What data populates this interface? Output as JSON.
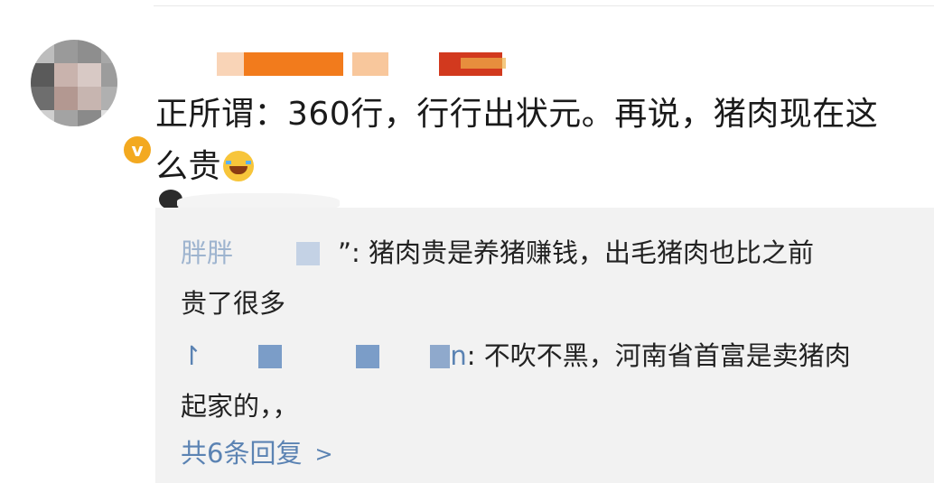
{
  "comment": {
    "author_name": "",
    "text_line1": "正所谓：360行，行行出状元。再说，猪肉现在这",
    "text_line2": "么贵",
    "emoji": "laughing-crying-emoji",
    "verified_badge": "v"
  },
  "replies": [
    {
      "author": "胖胖",
      "separator": "”: ",
      "text_line1": "猪肉贵是养猪赚钱，出毛猪肉也比之前",
      "text_line2": "贵了很多"
    },
    {
      "author": "↾",
      "author_tail": "n",
      "separator": ": ",
      "text_line1": "不吹不黑，河南省首富是卖猪肉",
      "text_line2": "起家的，，"
    }
  ],
  "more_replies_label": "共6条回复",
  "more_replies_chevron": ">",
  "colors": {
    "link_blue": "#5b83b3",
    "reply_bg": "#f2f2f2",
    "verified": "#f3a920",
    "name_orange": "#f27b1c"
  }
}
